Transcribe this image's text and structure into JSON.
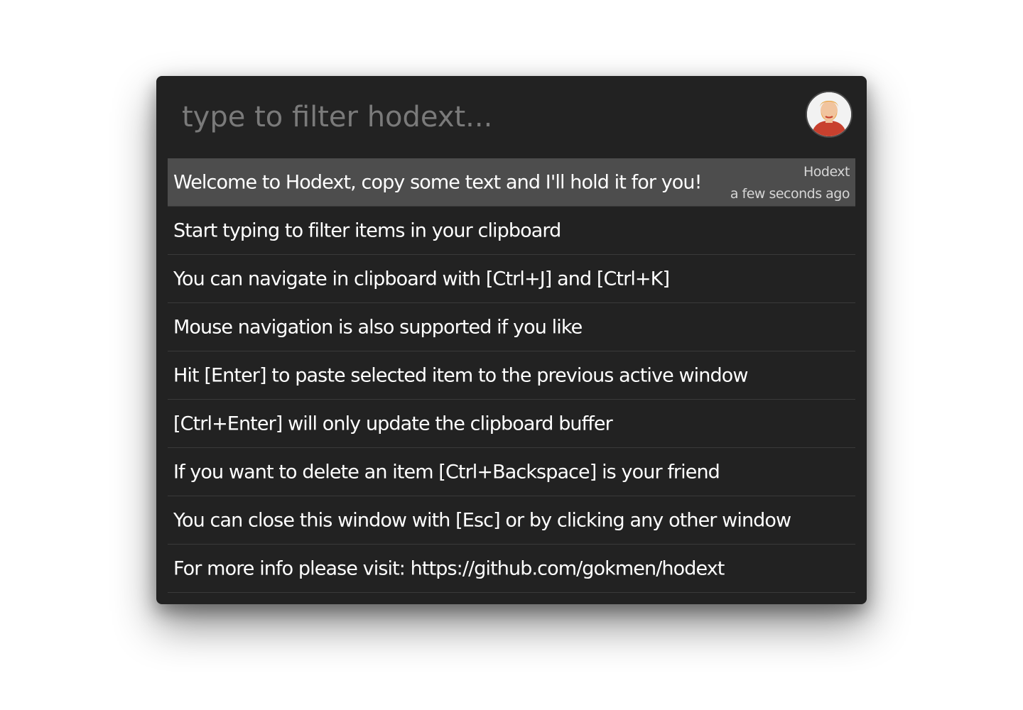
{
  "search": {
    "placeholder": "type to filter hodext...",
    "value": ""
  },
  "avatar": {
    "icon": "user-avatar-icon"
  },
  "items": [
    {
      "text": "Welcome to Hodext, copy some text and I'll hold it for you!",
      "source": "Hodext",
      "time": "a few seconds ago",
      "selected": true
    },
    {
      "text": "Start typing to filter items in your clipboard"
    },
    {
      "text": "You can navigate in clipboard with [Ctrl+J] and [Ctrl+K]"
    },
    {
      "text": "Mouse navigation is also supported if you like"
    },
    {
      "text": "Hit [Enter] to paste selected item to the previous active window"
    },
    {
      "text": "[Ctrl+Enter] will only update the clipboard buffer"
    },
    {
      "text": "If you want to delete an item [Ctrl+Backspace] is your friend"
    },
    {
      "text": "You can close this window with [Esc] or by clicking any other window"
    },
    {
      "text": "For more info please visit: https://github.com/gokmen/hodext"
    }
  ],
  "colors": {
    "window_bg": "#222222",
    "selected_bg": "#4d4d4d",
    "text": "#ffffff",
    "placeholder": "#7a7a7a",
    "divider": "#3a3a3a"
  }
}
